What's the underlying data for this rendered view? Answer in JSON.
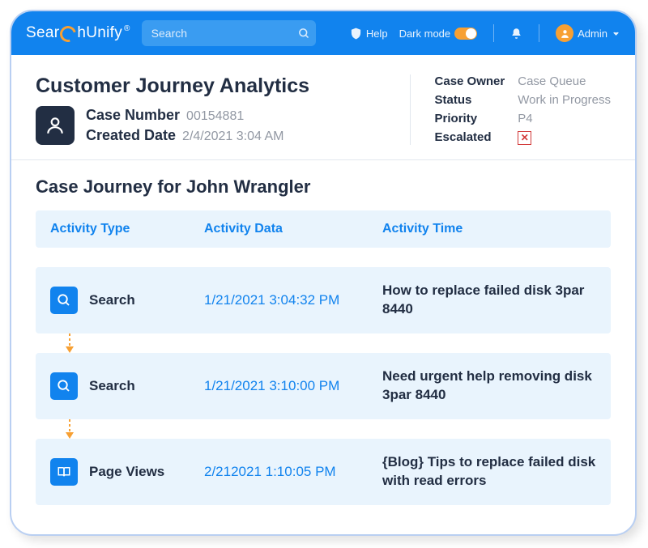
{
  "brand": {
    "pre": "Sear",
    "post": "hUnify",
    "trademark": "®"
  },
  "topbar": {
    "search_placeholder": "Search",
    "help_label": "Help",
    "darkmode_label": "Dark mode",
    "admin_label": "Admin"
  },
  "page": {
    "title": "Customer Journey Analytics",
    "case_number_label": "Case Number",
    "case_number_value": "00154881",
    "created_label": "Created Date",
    "created_value": "2/4/2021 3:04 AM"
  },
  "meta": {
    "owner_label": "Case Owner",
    "owner_value": "Case Queue",
    "status_label": "Status",
    "status_value": "Work in Progress",
    "priority_label": "Priority",
    "priority_value": "P4",
    "escalated_label": "Escalated"
  },
  "journey": {
    "title": "Case Journey for John Wrangler",
    "headers": {
      "type": "Activity Type",
      "data": "Activity Data",
      "time": "Activity Time"
    },
    "rows": [
      {
        "icon": "search",
        "type": "Search",
        "time": "1/21/2021  3:04:32 PM",
        "data": "How to replace failed disk 3par 8440"
      },
      {
        "icon": "search",
        "type": "Search",
        "time": "1/21/2021  3:10:00 PM",
        "data": "Need urgent help removing disk 3par 8440"
      },
      {
        "icon": "book",
        "type": "Page Views",
        "time": "2/212021  1:10:05 PM",
        "data": "{Blog} Tips to replace failed disk with read errors"
      }
    ]
  }
}
